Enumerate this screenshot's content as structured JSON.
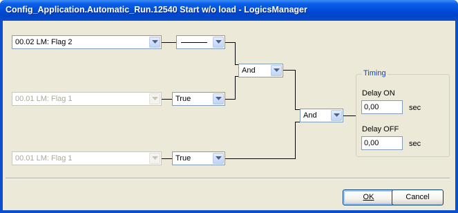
{
  "window": {
    "title": "Config_Application.Automatic_Run.12540 Start w/o load - LogicsManager"
  },
  "inputs": [
    {
      "value": "00.02 LM: Flag 2",
      "enabled": true
    },
    {
      "value": "00.01 LM: Flag 1",
      "enabled": false
    },
    {
      "value": "00.01 LM: Flag 1",
      "enabled": false
    }
  ],
  "signs": [
    {
      "value": "——————",
      "icon": "line-glyph"
    },
    {
      "value": "True"
    },
    {
      "value": "True"
    }
  ],
  "operators": [
    {
      "value": "And"
    },
    {
      "value": "And"
    }
  ],
  "timing": {
    "group_label": "Timing",
    "delay_on_label": "Delay ON",
    "delay_on_value": "0,00",
    "delay_on_unit": "sec",
    "delay_off_label": "Delay OFF",
    "delay_off_value": "0,00",
    "delay_off_unit": "sec"
  },
  "buttons": {
    "ok": "OK",
    "cancel": "Cancel"
  },
  "colors": {
    "titlebar": "#0049d6",
    "dialog_bg": "#ece9d8",
    "timing_label": "#0046d5"
  }
}
